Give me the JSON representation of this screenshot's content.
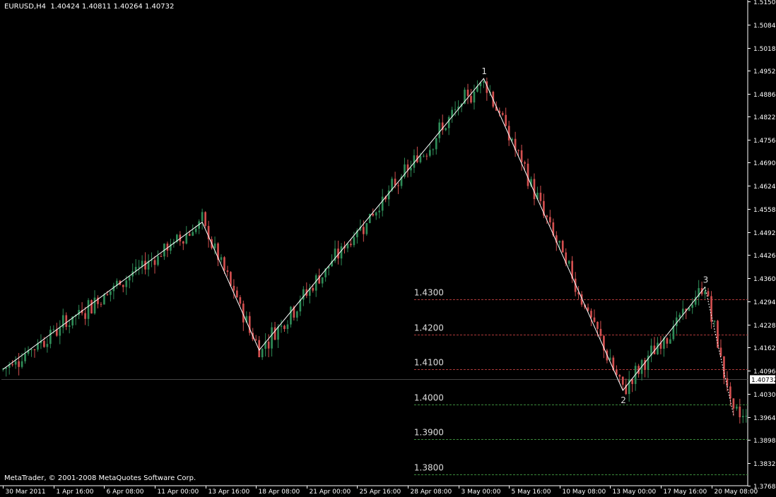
{
  "chart_title": {
    "symbol": "EURUSD,H4",
    "ohlc": "1.40424 1.40811 1.40264 1.40732"
  },
  "copyright": "MetaTrader, © 2001-2008 MetaQuotes Software Corp.",
  "colors": {
    "background": "#000000",
    "axis": "#ffffff",
    "bull_candle": "#2e8b57",
    "bear_candle": "#d24f4f",
    "zigzag": "#ffffff",
    "level_red": "#b03a3a",
    "level_green": "#3c8c3c",
    "price_tag_bg": "#ffffff"
  },
  "chart_data": {
    "type": "candlestick",
    "y_axis": {
      "ylim": [
        1.3768,
        1.515
      ],
      "tick_labels": [
        "1.51500",
        "1.50840",
        "1.50180",
        "1.49520",
        "1.48860",
        "1.48220",
        "1.47560",
        "1.46900",
        "1.46240",
        "1.45580",
        "1.44920",
        "1.44260",
        "1.43600",
        "1.42940",
        "1.42280",
        "1.41620",
        "1.40960",
        "1.40300",
        "1.39640",
        "1.38980",
        "1.38320",
        "1.37680"
      ],
      "current_price": "1.40732"
    },
    "x_axis": {
      "tick_labels": [
        "30 Mar 2011",
        "1 Apr 16:00",
        "6 Apr 08:00",
        "11 Apr 00:00",
        "13 Apr 16:00",
        "18 Apr 08:00",
        "21 Apr 00:00",
        "25 Apr 16:00",
        "28 Apr 08:00",
        "3 May 00:00",
        "5 May 16:00",
        "10 May 08:00",
        "13 May 00:00",
        "17 May 16:00",
        "20 May 08:00"
      ],
      "tick_bars": [
        0,
        16,
        32,
        48,
        64,
        80,
        96,
        112,
        128,
        144,
        160,
        176,
        192,
        208,
        224
      ],
      "total_bars": 236
    },
    "zigzag": [
      {
        "bar": 0,
        "price": 1.41
      },
      {
        "bar": 63,
        "price": 1.452
      },
      {
        "bar": 81,
        "price": 1.4155
      },
      {
        "bar": 152,
        "price": 1.493
      },
      {
        "bar": 196,
        "price": 1.404
      },
      {
        "bar": 222,
        "price": 1.4335
      },
      {
        "bar": 231,
        "price": 1.397
      }
    ],
    "wave_labels": [
      {
        "text": "1",
        "bar": 152,
        "price": 1.493,
        "position": "above"
      },
      {
        "text": "2",
        "bar": 196,
        "price": 1.404,
        "position": "below"
      },
      {
        "text": "3",
        "bar": 222,
        "price": 1.4335,
        "position": "above"
      }
    ],
    "levels": [
      {
        "price": 1.43,
        "label": "1.4300",
        "color": "red"
      },
      {
        "price": 1.42,
        "label": "1.4200",
        "color": "red"
      },
      {
        "price": 1.41,
        "label": "1.4100",
        "color": "red"
      },
      {
        "price": 1.4,
        "label": "1.4000",
        "color": "green"
      },
      {
        "price": 1.39,
        "label": "1.3900",
        "color": "green"
      },
      {
        "price": 1.38,
        "label": "1.3800",
        "color": "green"
      }
    ],
    "levels_start_bar": 130
  }
}
